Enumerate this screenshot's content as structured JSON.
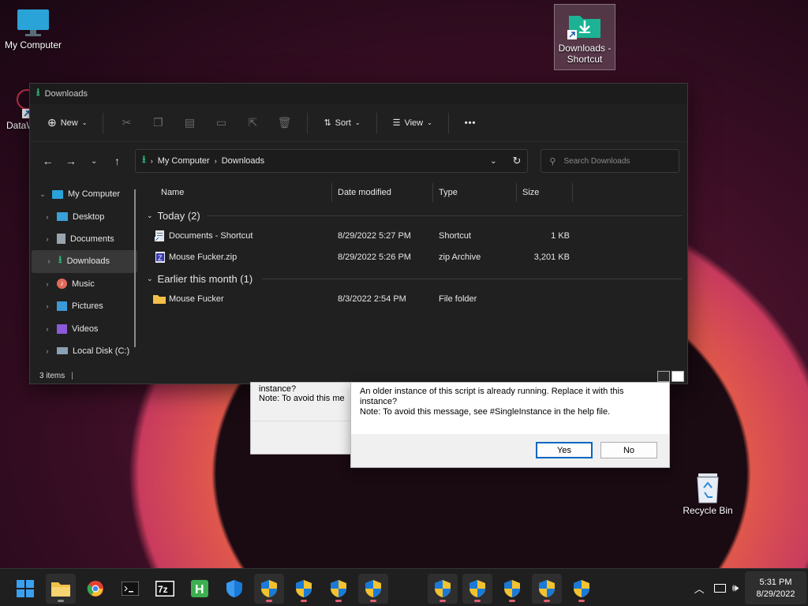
{
  "desktop": {
    "icons": [
      {
        "label": "My Computer"
      },
      {
        "label": "Downloads - Shortcut"
      },
      {
        "label": "DataW"
      },
      {
        "label": "Recycle Bin"
      }
    ]
  },
  "explorer": {
    "title": "Downloads",
    "toolbar": {
      "new_label": "New",
      "sort_label": "Sort",
      "view_label": "View",
      "more_label": "•••"
    },
    "address": {
      "crumb1": "My Computer",
      "crumb2": "Downloads"
    },
    "search": {
      "placeholder": "Search Downloads"
    },
    "nav": [
      {
        "label": "My Computer",
        "icon": "monitor-icon"
      },
      {
        "label": "Desktop",
        "icon": "desktop-icon"
      },
      {
        "label": "Documents",
        "icon": "documents-icon"
      },
      {
        "label": "Downloads",
        "icon": "download-icon"
      },
      {
        "label": "Music",
        "icon": "music-icon"
      },
      {
        "label": "Pictures",
        "icon": "pictures-icon"
      },
      {
        "label": "Videos",
        "icon": "videos-icon"
      },
      {
        "label": "Local Disk (C:)",
        "icon": "drive-icon"
      }
    ],
    "columns": {
      "name": "Name",
      "date": "Date modified",
      "type": "Type",
      "size": "Size"
    },
    "groups": [
      {
        "title": "Today (2)",
        "files": [
          {
            "name": "Documents - Shortcut",
            "date": "8/29/2022 5:27 PM",
            "type": "Shortcut",
            "size": "1 KB"
          },
          {
            "name": "Mouse Fucker.zip",
            "date": "8/29/2022 5:26 PM",
            "type": "zip Archive",
            "size": "3,201 KB"
          }
        ]
      },
      {
        "title": "Earlier this month (1)",
        "files": [
          {
            "name": "Mouse Fucker",
            "date": "8/3/2022 2:54 PM",
            "type": "File folder",
            "size": ""
          }
        ]
      }
    ],
    "status": "3 items"
  },
  "dialog_back": {
    "line1": "instance?",
    "line2": "Note: To avoid this me"
  },
  "dialog": {
    "line1": "An older instance of this script is already running.  Replace it with this",
    "line2": "instance?",
    "line3": "Note: To avoid this message, see #SingleInstance in the help file.",
    "yes_label": "Yes",
    "no_label": "No"
  },
  "taskbar": {
    "time": "5:31 PM",
    "date": "8/29/2022"
  },
  "colors": {
    "accent": "#0067c0",
    "download_green": "#2fb673"
  }
}
